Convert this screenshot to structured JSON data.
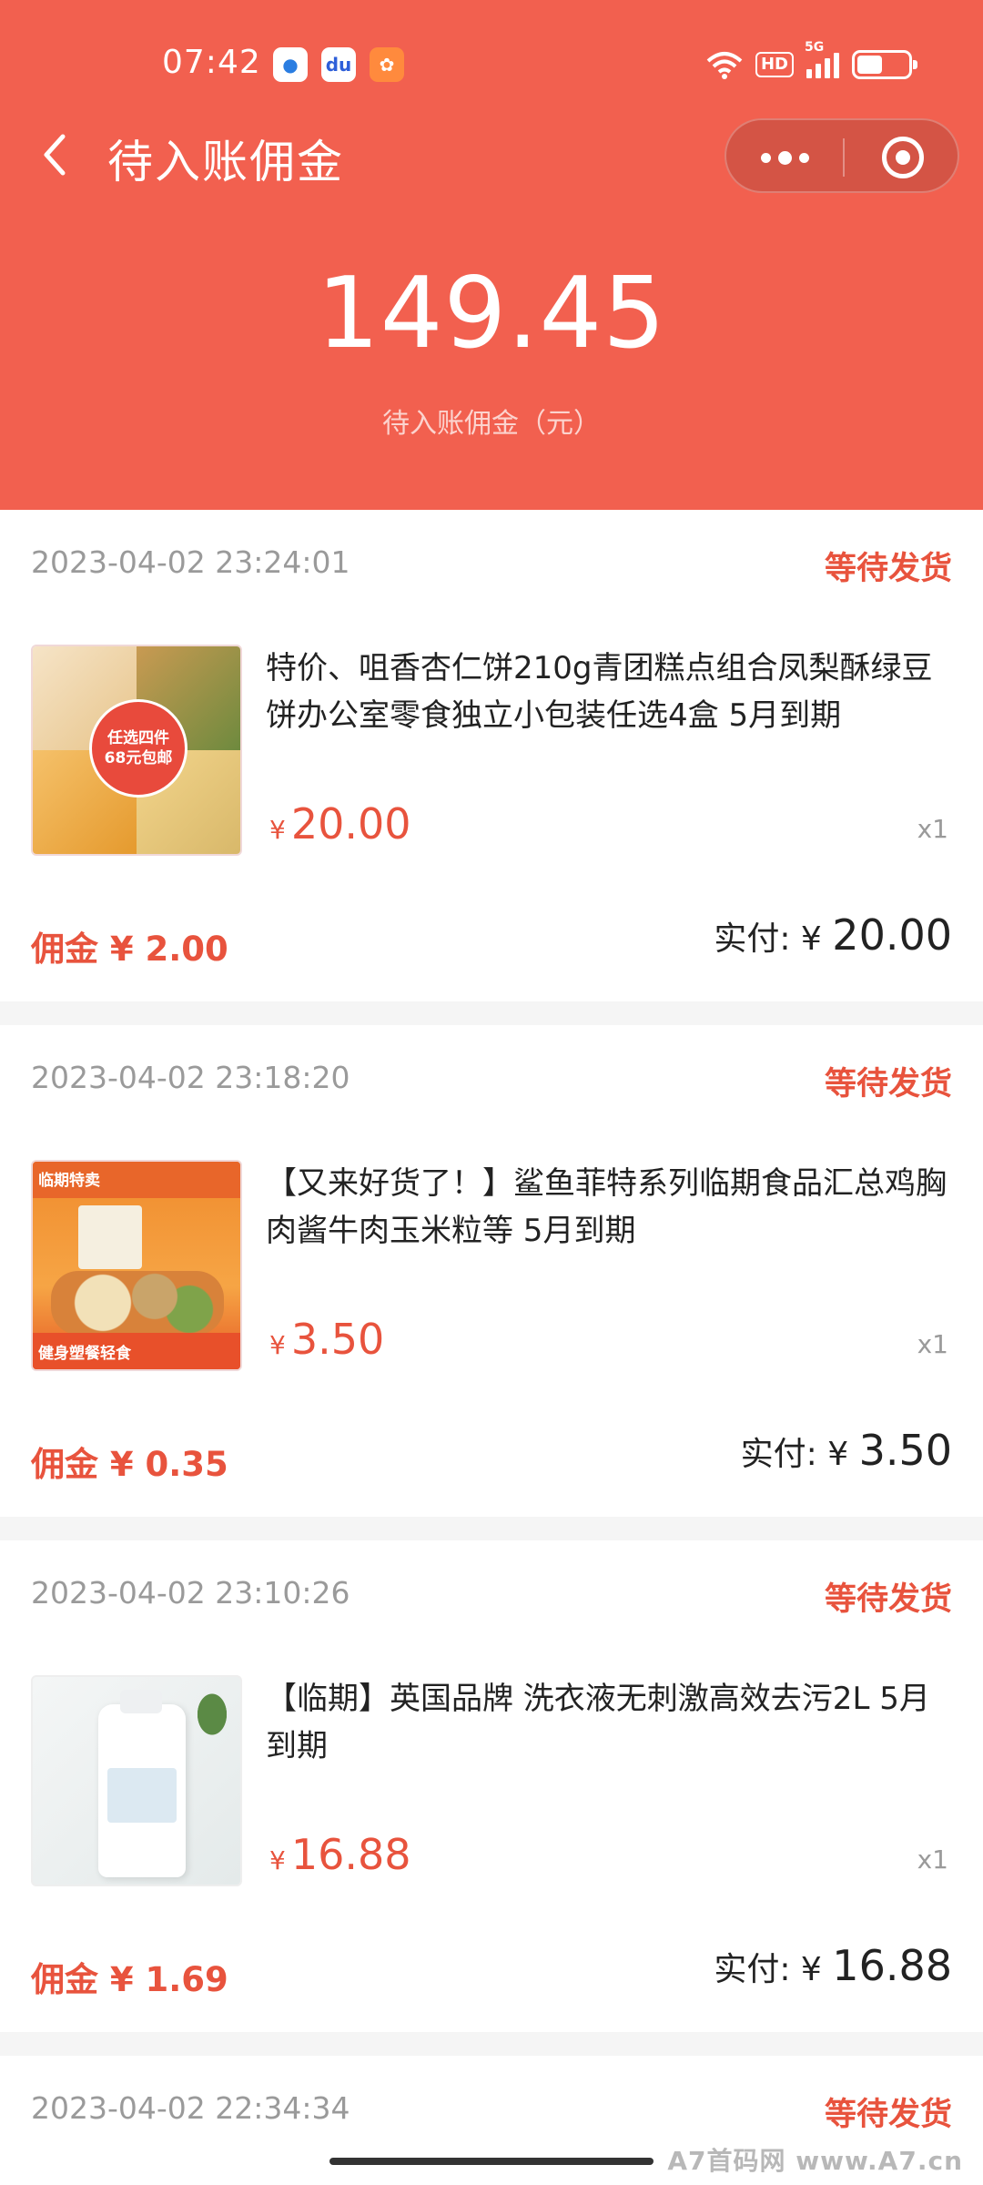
{
  "status_bar": {
    "time": "07:42",
    "network": "5G",
    "hd": "HD",
    "battery_level": 0.5
  },
  "nav": {
    "back_icon": "chevron-left-icon",
    "title": "待入账佣金",
    "more_icon": "more-dots-icon",
    "close_icon": "target-circle-icon"
  },
  "summary": {
    "amount": "149.45",
    "label": "待入账佣金（元）"
  },
  "colors": {
    "header_bg": "#f2604f",
    "accent": "#e8533d"
  },
  "orders": [
    {
      "time": "2023-04-02 23:24:01",
      "status": "等待发货",
      "title": "特价、咀香杏仁饼210g青团糕点组合凤梨酥绿豆饼办公室零食独立小包装任选4盒 5月到期",
      "price_symbol": "¥",
      "price": "20.00",
      "qty": "x1",
      "commission": "佣金 ¥ 2.00",
      "paid_label": "实付: ¥",
      "paid_value": "20.00",
      "thumb_text": [
        "任选四件",
        "68元包邮"
      ]
    },
    {
      "time": "2023-04-02 23:18:20",
      "status": "等待发货",
      "title": "【又来好货了！】鲨鱼菲特系列临期食品汇总鸡胸肉酱牛肉玉米粒等 5月到期",
      "price_symbol": "¥",
      "price": "3.50",
      "qty": "x1",
      "commission": "佣金 ¥ 0.35",
      "paid_label": "实付: ¥",
      "paid_value": "3.50",
      "thumb_text": [
        "临期特卖",
        "健身塑餐轻食"
      ]
    },
    {
      "time": "2023-04-02 23:10:26",
      "status": "等待发货",
      "title": "【临期】英国品牌 洗衣液无刺激高效去污2L 5月到期",
      "price_symbol": "¥",
      "price": "16.88",
      "qty": "x1",
      "commission": "佣金 ¥ 1.69",
      "paid_label": "实付: ¥",
      "paid_value": "16.88"
    },
    {
      "time": "2023-04-02 22:34:34",
      "status": "等待发货"
    }
  ],
  "watermark": "A7首码网 www.A7.cn"
}
